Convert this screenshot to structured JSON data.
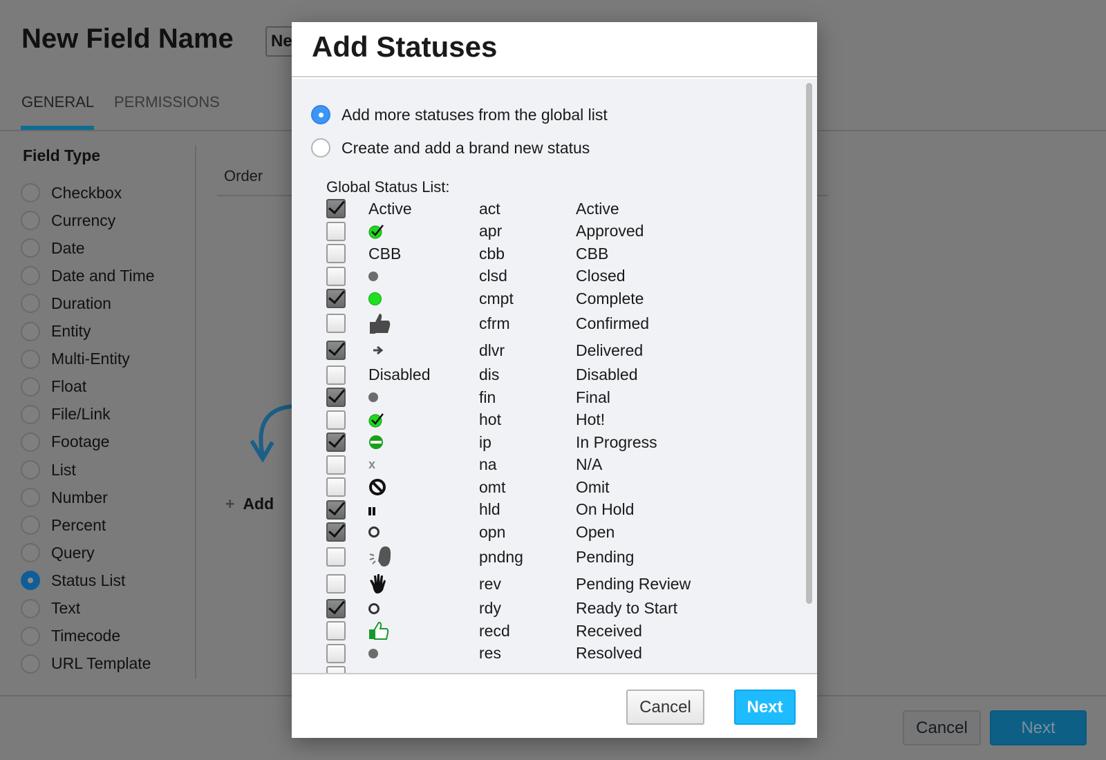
{
  "background": {
    "title": "New Field Name",
    "name_input_value": "Ne",
    "tabs": [
      {
        "label": "GENERAL",
        "active": true
      },
      {
        "label": "PERMISSIONS",
        "active": false
      }
    ],
    "field_type_heading": "Field Type",
    "field_types": [
      {
        "label": "Checkbox",
        "selected": false
      },
      {
        "label": "Currency",
        "selected": false
      },
      {
        "label": "Date",
        "selected": false
      },
      {
        "label": "Date and Time",
        "selected": false
      },
      {
        "label": "Duration",
        "selected": false
      },
      {
        "label": "Entity",
        "selected": false
      },
      {
        "label": "Multi-Entity",
        "selected": false
      },
      {
        "label": "Float",
        "selected": false
      },
      {
        "label": "File/Link",
        "selected": false
      },
      {
        "label": "Footage",
        "selected": false
      },
      {
        "label": "List",
        "selected": false
      },
      {
        "label": "Number",
        "selected": false
      },
      {
        "label": "Percent",
        "selected": false
      },
      {
        "label": "Query",
        "selected": false
      },
      {
        "label": "Status List",
        "selected": true
      },
      {
        "label": "Text",
        "selected": false
      },
      {
        "label": "Timecode",
        "selected": false
      },
      {
        "label": "URL Template",
        "selected": false
      }
    ],
    "order_label": "Order",
    "add_label": "Add",
    "cancel_label": "Cancel",
    "next_label": "Next"
  },
  "modal": {
    "title": "Add Statuses",
    "options": [
      {
        "label": "Add more statuses from the global list",
        "selected": true
      },
      {
        "label": "Create and add a brand new status",
        "selected": false
      }
    ],
    "list_label": "Global Status List:",
    "statuses": [
      {
        "checked": true,
        "icon_text": "Active",
        "icon": null,
        "code": "act",
        "name": "Active"
      },
      {
        "checked": false,
        "icon_text": null,
        "icon": "green-check-icon",
        "code": "apr",
        "name": "Approved"
      },
      {
        "checked": false,
        "icon_text": "CBB",
        "icon": null,
        "code": "cbb",
        "name": "CBB"
      },
      {
        "checked": false,
        "icon_text": null,
        "icon": "gray-dot-icon",
        "code": "clsd",
        "name": "Closed"
      },
      {
        "checked": true,
        "icon_text": null,
        "icon": "green-dot-icon",
        "code": "cmpt",
        "name": "Complete"
      },
      {
        "checked": false,
        "icon_text": null,
        "icon": "thumbs-up-icon",
        "code": "cfrm",
        "name": "Confirmed"
      },
      {
        "checked": true,
        "icon_text": null,
        "icon": "arrow-right-icon",
        "code": "dlvr",
        "name": "Delivered"
      },
      {
        "checked": false,
        "icon_text": "Disabled",
        "icon": null,
        "code": "dis",
        "name": "Disabled"
      },
      {
        "checked": true,
        "icon_text": null,
        "icon": "gray-dot-icon",
        "code": "fin",
        "name": "Final"
      },
      {
        "checked": false,
        "icon_text": null,
        "icon": "green-check-icon",
        "code": "hot",
        "name": "Hot!"
      },
      {
        "checked": true,
        "icon_text": null,
        "icon": "half-green-dot-icon",
        "code": "ip",
        "name": "In Progress"
      },
      {
        "checked": false,
        "icon_text": null,
        "icon": "x-icon",
        "code": "na",
        "name": "N/A"
      },
      {
        "checked": false,
        "icon_text": null,
        "icon": "no-entry-icon",
        "code": "omt",
        "name": "Omit"
      },
      {
        "checked": true,
        "icon_text": null,
        "icon": "pause-icon",
        "code": "hld",
        "name": "On Hold"
      },
      {
        "checked": true,
        "icon_text": null,
        "icon": "ring-icon",
        "code": "opn",
        "name": "Open"
      },
      {
        "checked": false,
        "icon_text": null,
        "icon": "speaking-head-icon",
        "code": "pndng",
        "name": "Pending"
      },
      {
        "checked": false,
        "icon_text": null,
        "icon": "hand-icon",
        "code": "rev",
        "name": "Pending Review"
      },
      {
        "checked": true,
        "icon_text": null,
        "icon": "ring-icon",
        "code": "rdy",
        "name": "Ready to Start"
      },
      {
        "checked": false,
        "icon_text": null,
        "icon": "green-thumbs-up-icon",
        "code": "recd",
        "name": "Received"
      },
      {
        "checked": false,
        "icon_text": null,
        "icon": "gray-dot-icon",
        "code": "res",
        "name": "Resolved"
      }
    ],
    "cancel_label": "Cancel",
    "next_label": "Next"
  },
  "colors": {
    "primary": "#1ebcff",
    "radio_selected": "#3d96f5",
    "tab_accent": "#0f6d92",
    "overlay": "#7b7b7c"
  }
}
